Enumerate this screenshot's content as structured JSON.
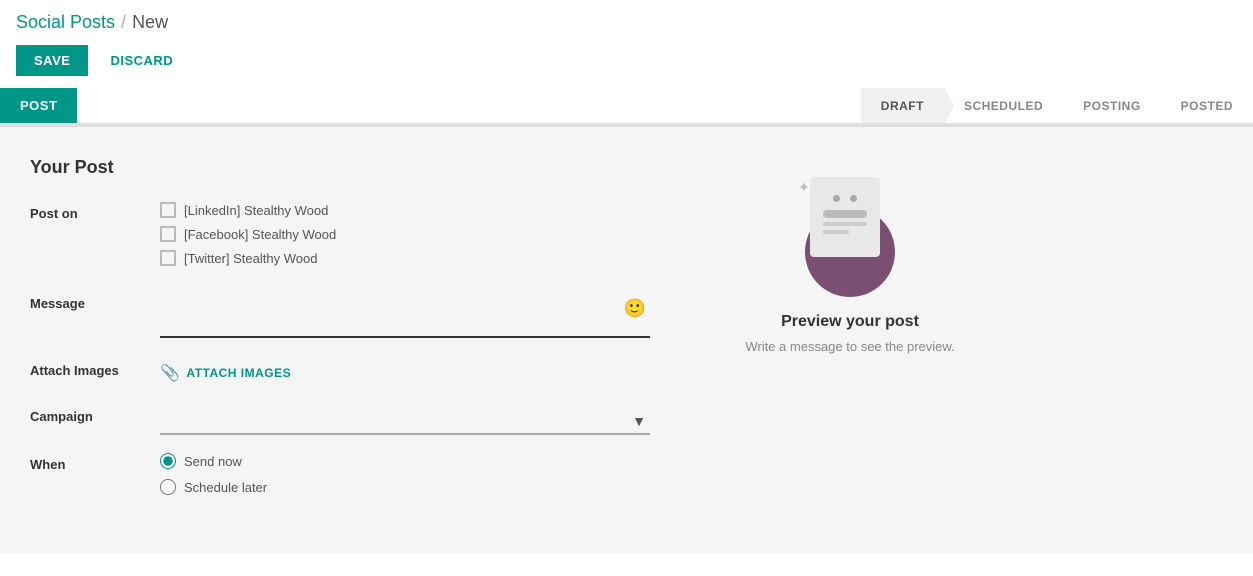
{
  "breadcrumb": {
    "parent": "Social Posts",
    "separator": "/",
    "current": "New"
  },
  "actions": {
    "save_label": "SAVE",
    "discard_label": "DISCARD"
  },
  "tabs": {
    "post_label": "POST",
    "statuses": [
      {
        "id": "draft",
        "label": "DRAFT",
        "active": true
      },
      {
        "id": "scheduled",
        "label": "SCHEDULED",
        "active": false
      },
      {
        "id": "posting",
        "label": "POSTING",
        "active": false
      },
      {
        "id": "posted",
        "label": "POSTED",
        "active": false
      }
    ]
  },
  "form": {
    "section_title": "Your Post",
    "post_on_label": "Post on",
    "platforms": [
      {
        "id": "linkedin",
        "label": "[LinkedIn] Stealthy Wood",
        "checked": false
      },
      {
        "id": "facebook",
        "label": "[Facebook] Stealthy Wood",
        "checked": false
      },
      {
        "id": "twitter",
        "label": "[Twitter] Stealthy Wood",
        "checked": false
      }
    ],
    "message_label": "Message",
    "message_value": "",
    "message_placeholder": "",
    "attach_images_label": "Attach Images",
    "attach_btn_label": "ATTACH IMAGES",
    "campaign_label": "Campaign",
    "campaign_placeholder": "",
    "when_label": "When",
    "when_options": [
      {
        "id": "send_now",
        "label": "Send now",
        "checked": true
      },
      {
        "id": "schedule_later",
        "label": "Schedule later",
        "checked": false
      }
    ]
  },
  "preview": {
    "title": "Preview your post",
    "subtitle": "Write a message to see the preview."
  },
  "colors": {
    "primary": "#009688",
    "circle_bg": "#7b4f72"
  }
}
